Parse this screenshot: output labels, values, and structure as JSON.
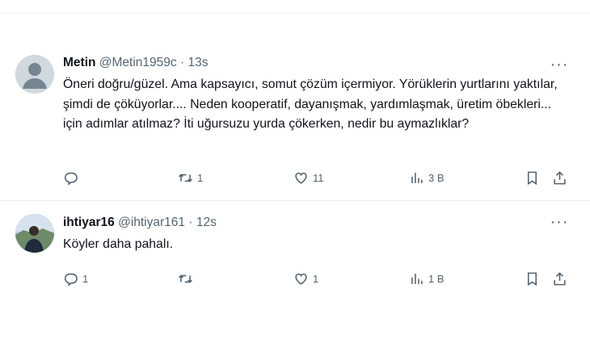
{
  "tweets": [
    {
      "name": "Metin",
      "handle": "@Metin1959c",
      "separator": "·",
      "time": "13s",
      "text": "Öneri doğru/güzel. Ama kapsayıcı, somut çözüm içermiyor. Yörüklerin yurtlarını yaktılar, şimdi de çöküyorlar.... Neden kooperatif, dayanışmak, yardımlaşmak, üretim öbekleri... için adımlar atılmaz? İti uğursuzu yurda çökerken, nedir bu aymazlıklar?",
      "more_label": "···",
      "reply_count": "",
      "retweet_count": "1",
      "like_count": "11",
      "views_count": "3 B",
      "icons": {
        "avatar": "default-avatar",
        "reply": "reply-icon",
        "retweet": "retweet-icon",
        "like": "heart-icon",
        "views": "views-icon",
        "bookmark": "bookmark-icon",
        "share": "share-icon"
      }
    },
    {
      "name": "ihtiyar16",
      "handle": "@ihtiyar161",
      "separator": "·",
      "time": "12s",
      "text": "Köyler daha pahalı.",
      "more_label": "···",
      "reply_count": "1",
      "retweet_count": "",
      "like_count": "1",
      "views_count": "1 B",
      "icons": {
        "avatar": "photo-avatar",
        "reply": "reply-icon",
        "retweet": "retweet-icon",
        "like": "heart-icon",
        "views": "views-icon",
        "bookmark": "bookmark-icon",
        "share": "share-icon"
      }
    }
  ],
  "colors": {
    "text": "#0f1419",
    "secondary": "#536471",
    "divider": "#eff3f4"
  }
}
